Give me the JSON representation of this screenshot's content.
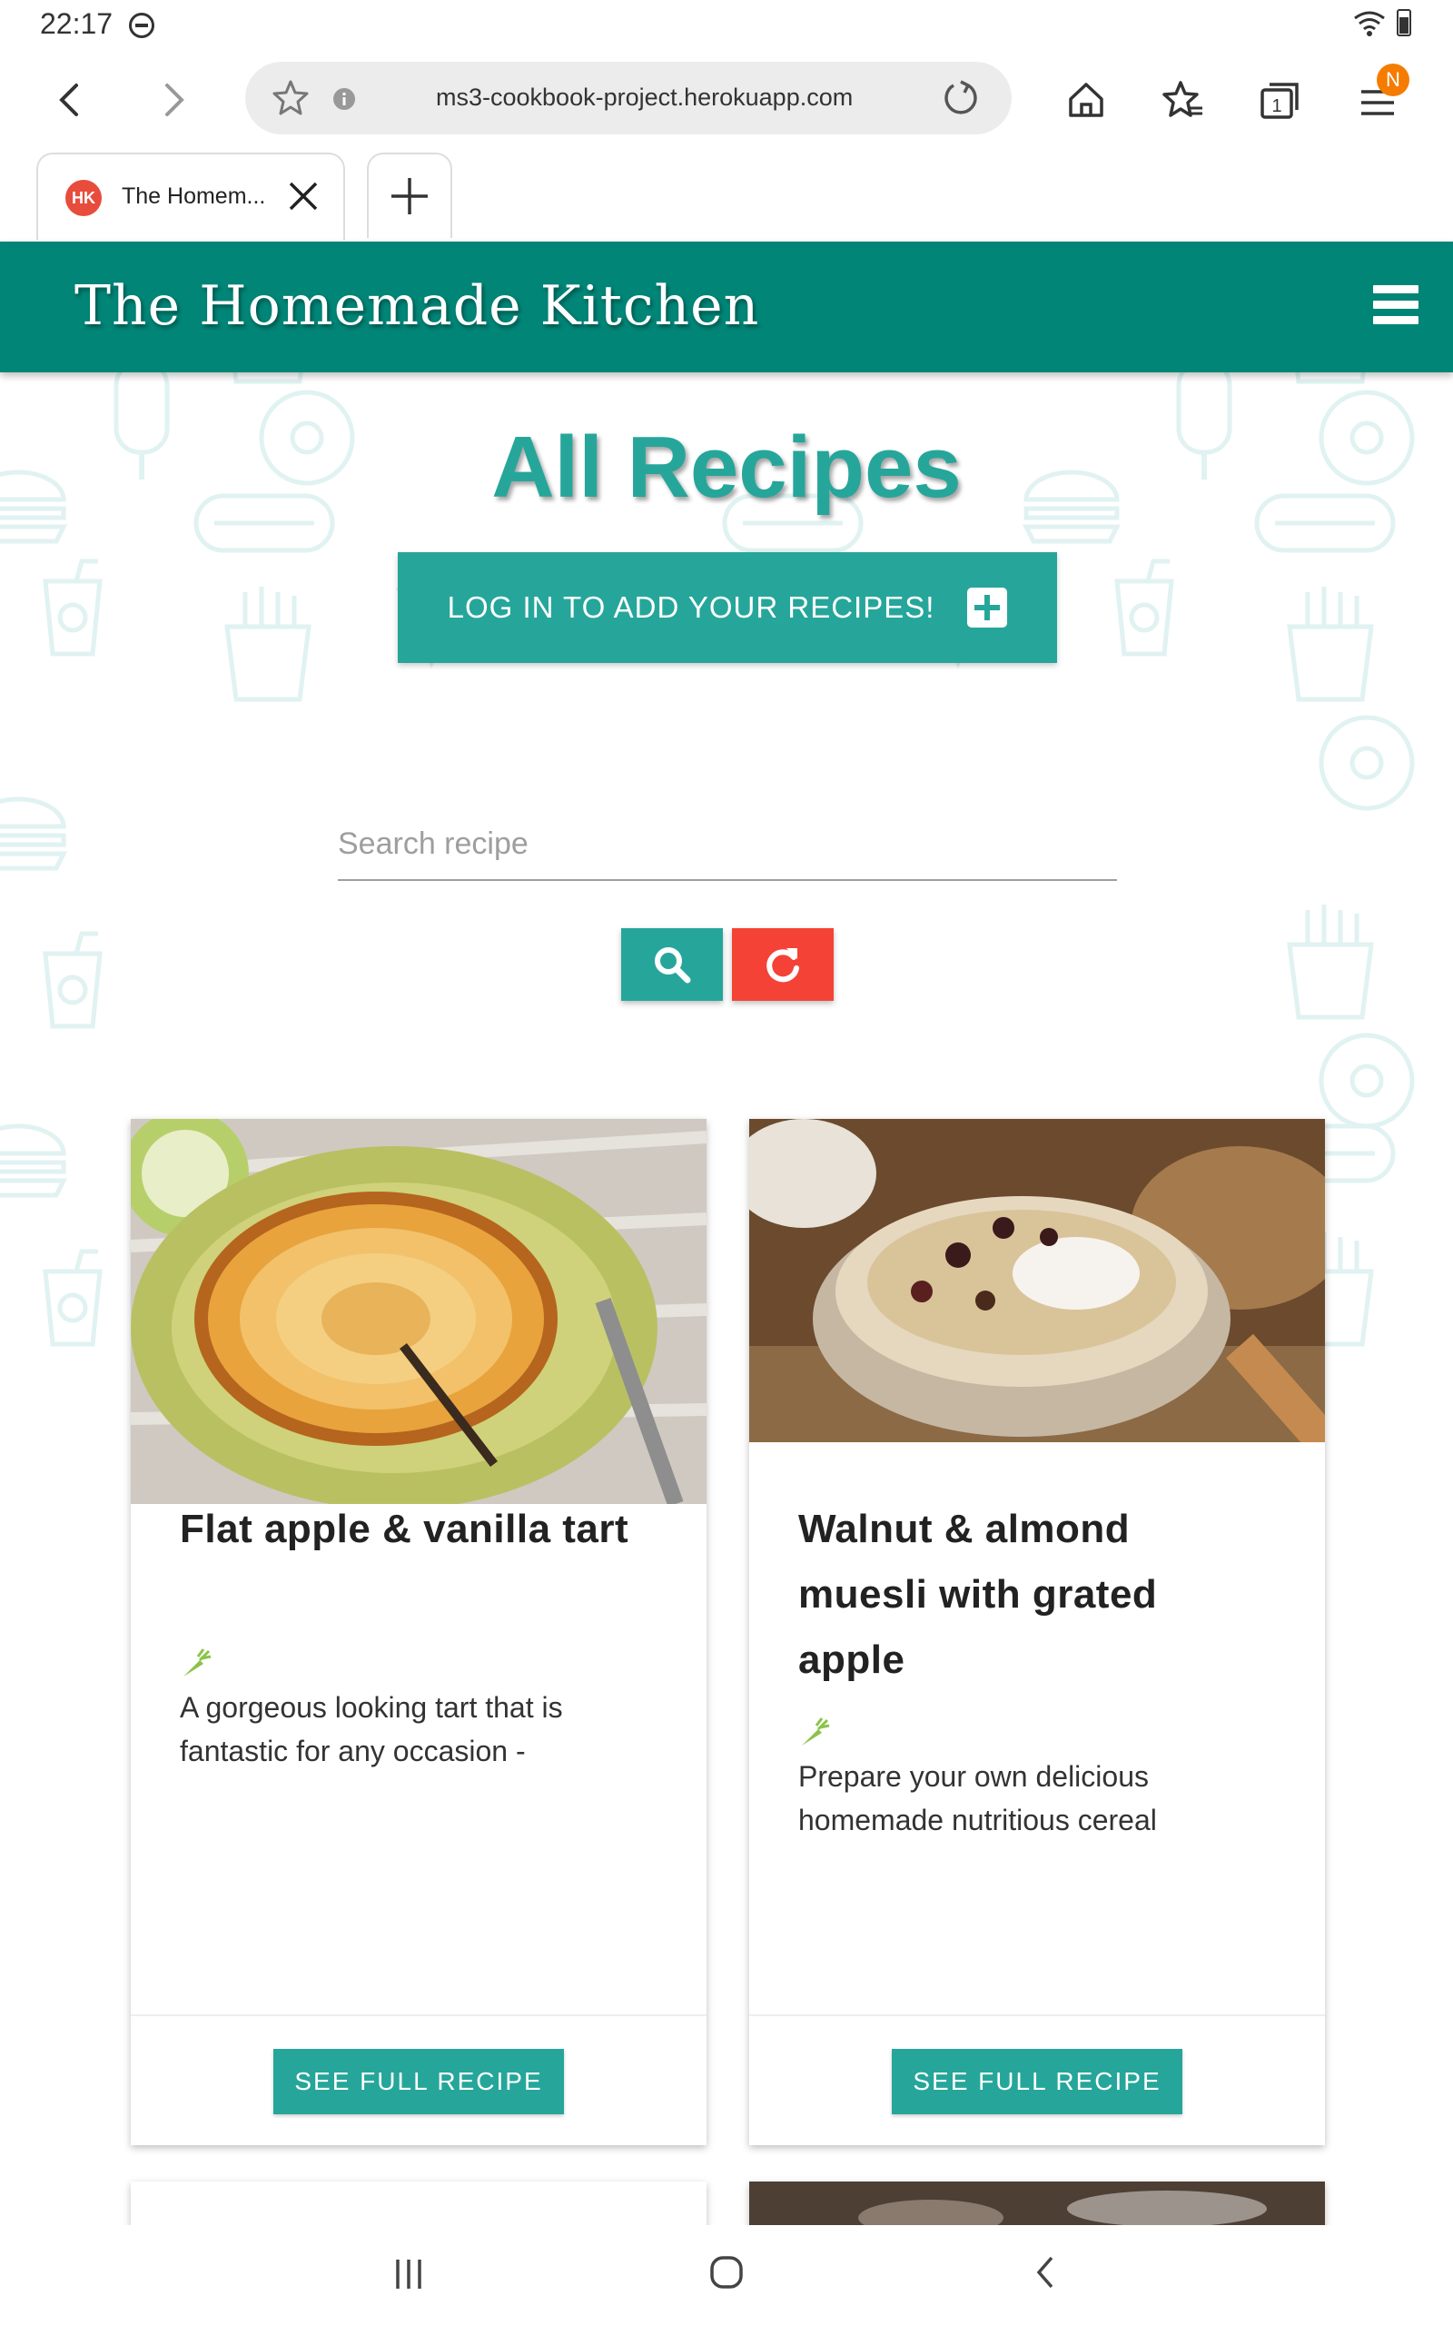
{
  "status": {
    "time": "22:17"
  },
  "browser": {
    "url": "ms3-cookbook-project.herokuapp.com",
    "tab_title": "The Homem...",
    "tab_favicon": "HK",
    "tab_count": "1",
    "profile_badge": "N"
  },
  "site": {
    "brand": "The Homemade Kitchen",
    "page_title": "All Recipes",
    "login_button": "LOG IN TO ADD YOUR RECIPES!",
    "search_placeholder": "Search recipe"
  },
  "recipes": [
    {
      "title_lines": [
        "Flat apple & vanilla tart"
      ],
      "description_lines": [
        "A gorgeous looking tart that is",
        "fantastic for any occasion -"
      ],
      "button": "SEE FULL RECIPE"
    },
    {
      "title_lines": [
        "Walnut & almond",
        "muesli with grated",
        "apple"
      ],
      "description_lines": [
        "Prepare your own delicious",
        "homemade nutritious cereal"
      ],
      "button": "SEE FULL RECIPE"
    }
  ],
  "colors": {
    "nav": "#008577",
    "accent": "#26a69a",
    "reset": "#f44336",
    "leaf": "#8bc34a"
  }
}
